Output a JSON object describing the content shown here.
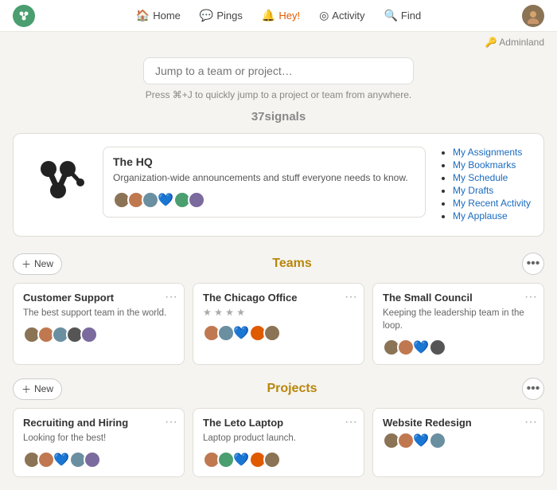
{
  "nav": {
    "logo_alt": "Basecamp logo",
    "links": [
      {
        "label": "Home",
        "icon": "🏠",
        "active": true
      },
      {
        "label": "Pings",
        "icon": "💬",
        "active": false
      },
      {
        "label": "Hey!",
        "icon": "🔔",
        "active": false,
        "hey": true
      },
      {
        "label": "Activity",
        "icon": "◎",
        "active": false
      },
      {
        "label": "Find",
        "icon": "🔍",
        "active": false
      }
    ],
    "adminland_label": "Adminland",
    "adminland_icon": "🔑"
  },
  "search": {
    "placeholder": "Jump to a team or project…",
    "hint": "Press ⌘+J to quickly jump to a project or team from anywhere."
  },
  "company": {
    "name": "37signals",
    "hq": {
      "title": "The HQ",
      "description": "Organization-wide announcements and stuff everyone needs to know.",
      "links": [
        "My Assignments",
        "My Bookmarks",
        "My Schedule",
        "My Drafts",
        "My Recent Activity",
        "My Applause"
      ],
      "avatars": [
        "#8b7355",
        "#c07850",
        "#6a8fa0",
        "#e05a00",
        "#4a9e6f",
        "#7a6a9e"
      ],
      "has_heart": true
    }
  },
  "teams": {
    "section_title": "Teams",
    "new_label": "New",
    "cards": [
      {
        "title": "Customer Support",
        "description": "The best support team in the world.",
        "avatars": [
          "#8b7355",
          "#c07850",
          "#6a8fa0",
          "#555",
          "#7a6a9e"
        ],
        "has_heart": false
      },
      {
        "title": "The Chicago Office",
        "stars": "★ ★ ★ ★",
        "description": "",
        "avatars": [
          "#c07850",
          "#6a8fa0",
          "#4a9e6f",
          "#e05a00",
          "#8b7355"
        ],
        "has_heart": true
      },
      {
        "title": "The Small Council",
        "description": "Keeping the leadership team in the loop.",
        "avatars": [
          "#8b7355",
          "#c07850",
          "#5bc0de",
          "#555"
        ],
        "has_heart": true
      }
    ]
  },
  "projects": {
    "section_title": "Projects",
    "new_label": "New",
    "cards": [
      {
        "title": "Recruiting and Hiring",
        "description": "Looking for the best!",
        "avatars": [
          "#8b7355",
          "#c07850",
          "#5bc0de",
          "#6a8fa0",
          "#7a6a9e"
        ],
        "has_heart": true
      },
      {
        "title": "The Leto Laptop",
        "description": "Laptop product launch.",
        "avatars": [
          "#c07850",
          "#4a9e6f",
          "#5bc0de",
          "#e05a00",
          "#8b7355"
        ],
        "has_heart": true
      },
      {
        "title": "Website Redesign",
        "description": "",
        "avatars": [
          "#8b7355",
          "#c07850",
          "#5bc0de",
          "#6a8fa0"
        ],
        "has_heart": true
      }
    ]
  }
}
